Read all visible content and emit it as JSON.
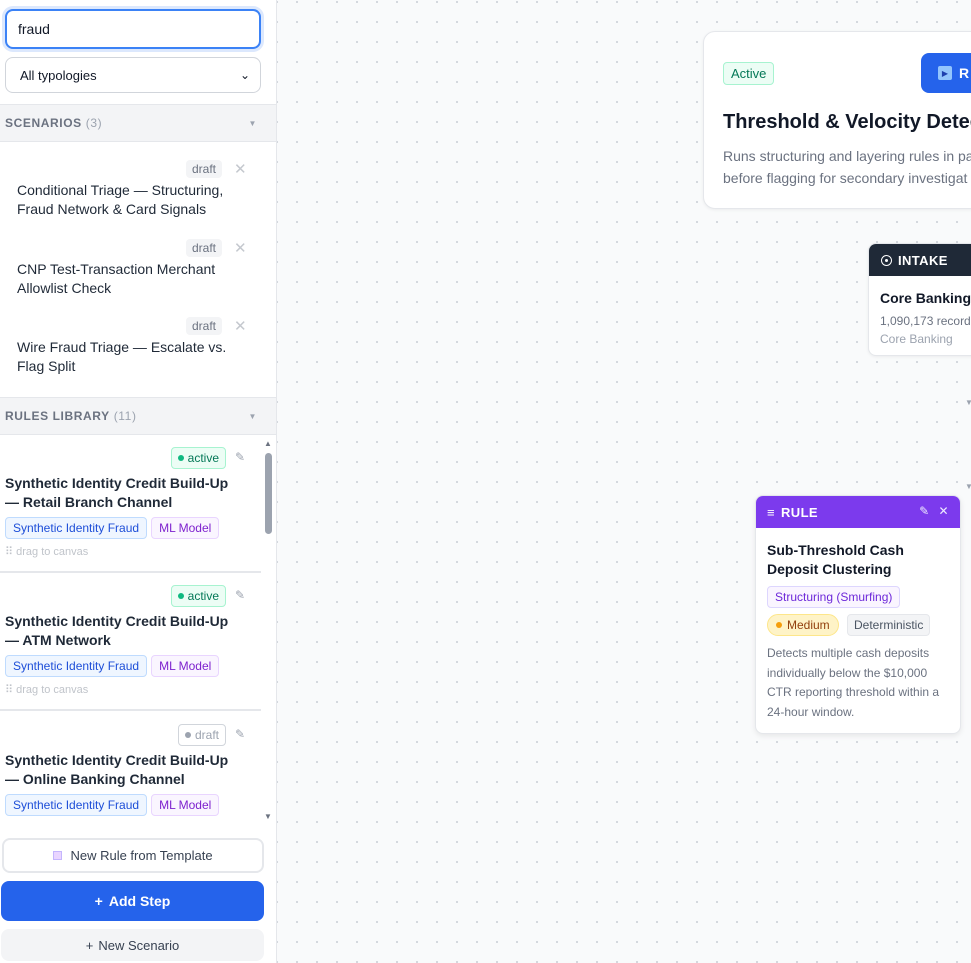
{
  "search": {
    "value": "fraud",
    "placeholder": ""
  },
  "typology_filter": {
    "selected": "All typologies"
  },
  "scenarios": {
    "label": "SCENARIOS",
    "count": "(3)",
    "items": [
      {
        "status": "draft",
        "title": "Conditional Triage — Structuring, Fraud Network & Card Signals"
      },
      {
        "status": "draft",
        "title": "CNP Test-Transaction Merchant Allowlist Check"
      },
      {
        "status": "draft",
        "title": "Wire Fraud Triage — Escalate vs. Flag Split"
      }
    ]
  },
  "rules_library": {
    "label": "RULES LIBRARY",
    "count": "(11)",
    "drag_hint": "drag to canvas",
    "items": [
      {
        "status": "active",
        "title": "Synthetic Identity Credit Build-Up — Retail Branch Channel",
        "tags": [
          "Synthetic Identity Fraud",
          "ML Model"
        ]
      },
      {
        "status": "active",
        "title": "Synthetic Identity Credit Build-Up — ATM Network",
        "tags": [
          "Synthetic Identity Fraud",
          "ML Model"
        ]
      },
      {
        "status": "draft",
        "title": "Synthetic Identity Credit Build-Up — Online Banking Channel",
        "tags": [
          "Synthetic Identity Fraud",
          "ML Model"
        ]
      }
    ]
  },
  "buttons": {
    "new_rule_template": "New Rule from Template",
    "add_step": "Add Step",
    "new_scenario": "New Scenario"
  },
  "canvas": {
    "scenario_header": {
      "status": "Active",
      "run_label": "R",
      "title": "Threshold & Velocity Detec",
      "description_line1": "Runs structuring and layering rules in pa",
      "description_line2": "before flagging for secondary investigat"
    },
    "intake_node": {
      "type_label": "INTAKE",
      "name": "Core Banking",
      "records": "1,090,173 records",
      "source": "Core Banking"
    },
    "rule_node": {
      "type_label": "RULE",
      "name": "Sub-Threshold Cash Deposit Clustering",
      "typology": "Structuring (Smurfing)",
      "severity": "Medium",
      "method": "Deterministic",
      "description": "Detects multiple cash deposits individually below the $10,000 CTR reporting threshold within a 24-hour window."
    }
  },
  "colors": {
    "accent": "#2563eb",
    "rule_header": "#7c3aed",
    "intake_header": "#1f2937",
    "active_green": "#047857"
  }
}
